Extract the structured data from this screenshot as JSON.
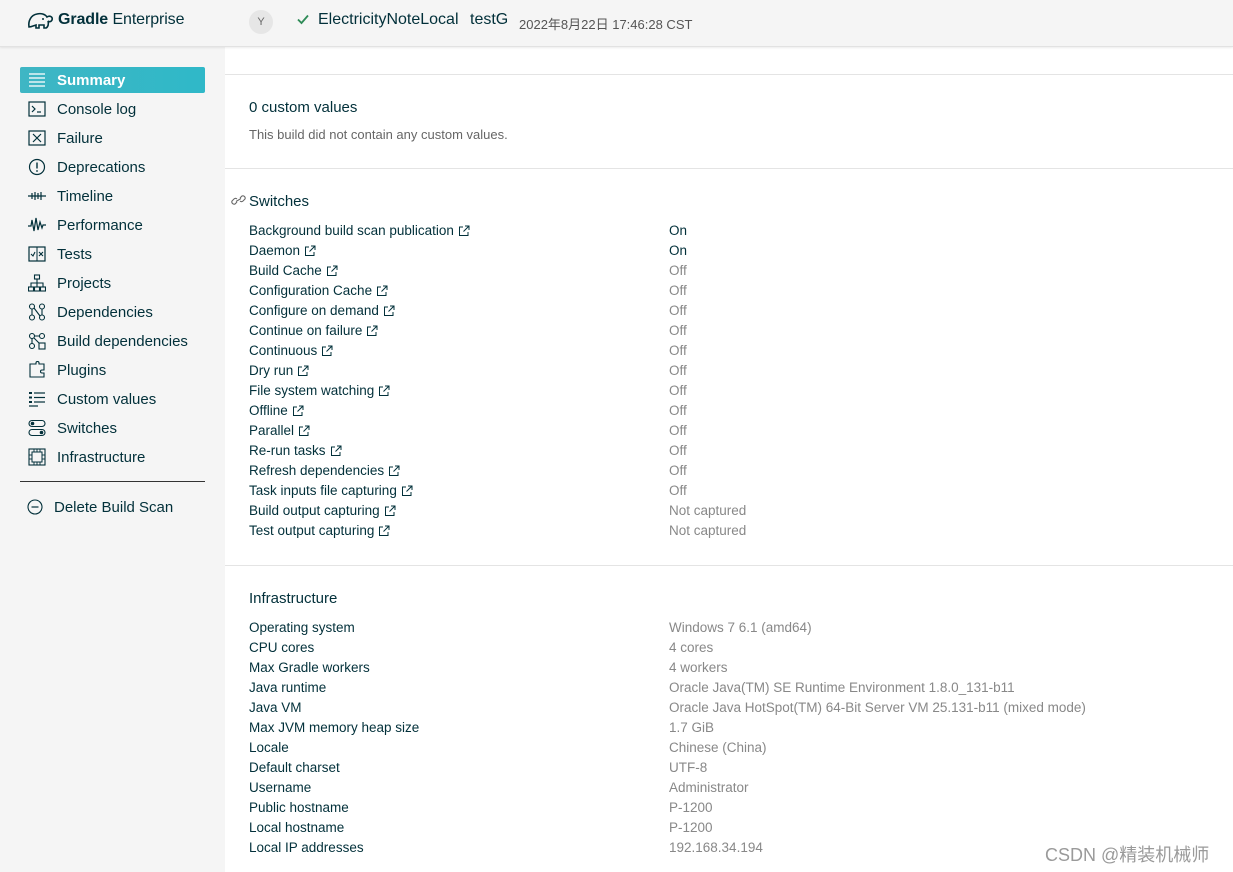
{
  "app": {
    "brand_bold": "Gradle",
    "brand_light": "Enterprise"
  },
  "header": {
    "avatar_initial": "Y",
    "project": "ElectricityNoteLocal",
    "task": "testG",
    "timestamp": "2022年8月22日 17:46:28 CST",
    "status_color": "#2e8b57"
  },
  "sidebar": {
    "items": [
      {
        "label": "Summary",
        "icon": "summary-icon",
        "active": true
      },
      {
        "label": "Console log",
        "icon": "console-icon"
      },
      {
        "label": "Failure",
        "icon": "failure-icon"
      },
      {
        "label": "Deprecations",
        "icon": "deprecations-icon"
      },
      {
        "label": "Timeline",
        "icon": "timeline-icon"
      },
      {
        "label": "Performance",
        "icon": "performance-icon"
      },
      {
        "label": "Tests",
        "icon": "tests-icon"
      },
      {
        "label": "Projects",
        "icon": "projects-icon"
      },
      {
        "label": "Dependencies",
        "icon": "dependencies-icon"
      },
      {
        "label": "Build dependencies",
        "icon": "build-dependencies-icon"
      },
      {
        "label": "Plugins",
        "icon": "plugins-icon"
      },
      {
        "label": "Custom values",
        "icon": "custom-values-icon"
      },
      {
        "label": "Switches",
        "icon": "switches-icon"
      },
      {
        "label": "Infrastructure",
        "icon": "infrastructure-icon"
      }
    ],
    "delete_label": "Delete Build Scan",
    "accent": "#3fb6c4"
  },
  "custom_values": {
    "title": "0 custom values",
    "note": "This build did not contain any custom values."
  },
  "switches": {
    "title": "Switches",
    "rows": [
      {
        "key": "Background build scan publication",
        "value": "On"
      },
      {
        "key": "Daemon",
        "value": "On"
      },
      {
        "key": "Build Cache",
        "value": "Off"
      },
      {
        "key": "Configuration Cache",
        "value": "Off"
      },
      {
        "key": "Configure on demand",
        "value": "Off"
      },
      {
        "key": "Continue on failure",
        "value": "Off"
      },
      {
        "key": "Continuous",
        "value": "Off"
      },
      {
        "key": "Dry run",
        "value": "Off"
      },
      {
        "key": "File system watching",
        "value": "Off"
      },
      {
        "key": "Offline",
        "value": "Off"
      },
      {
        "key": "Parallel",
        "value": "Off"
      },
      {
        "key": "Re-run tasks",
        "value": "Off"
      },
      {
        "key": "Refresh dependencies",
        "value": "Off"
      },
      {
        "key": "Task inputs file capturing",
        "value": "Off"
      },
      {
        "key": "Build output capturing",
        "value": "Not captured"
      },
      {
        "key": "Test output capturing",
        "value": "Not captured"
      }
    ]
  },
  "infrastructure": {
    "title": "Infrastructure",
    "rows": [
      {
        "key": "Operating system",
        "value": "Windows 7 6.1 (amd64)"
      },
      {
        "key": "CPU cores",
        "value": "4 cores"
      },
      {
        "key": "Max Gradle workers",
        "value": "4 workers"
      },
      {
        "key": "Java runtime",
        "value": "Oracle Java(TM) SE Runtime Environment 1.8.0_131-b11"
      },
      {
        "key": "Java VM",
        "value": "Oracle Java HotSpot(TM) 64-Bit Server VM 25.131-b11 (mixed mode)"
      },
      {
        "key": "Max JVM memory heap size",
        "value": "1.7 GiB"
      },
      {
        "key": "Locale",
        "value": "Chinese (China)"
      },
      {
        "key": "Default charset",
        "value": "UTF-8"
      },
      {
        "key": "Username",
        "value": "Administrator"
      },
      {
        "key": "Public hostname",
        "value": "P-1200"
      },
      {
        "key": "Local hostname",
        "value": "P-1200"
      },
      {
        "key": "Local IP addresses",
        "value": "192.168.34.194"
      }
    ]
  },
  "watermark": "CSDN @精装机械师"
}
